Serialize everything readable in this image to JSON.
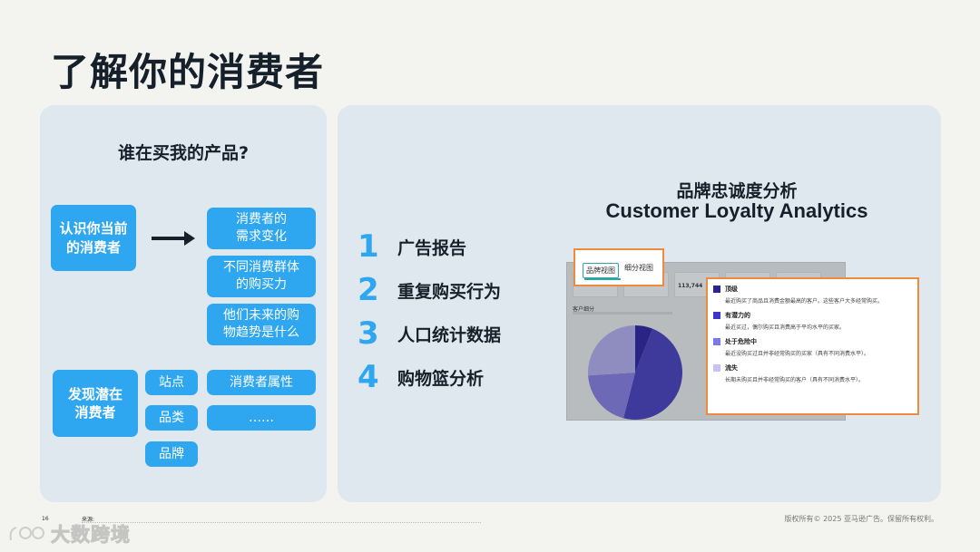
{
  "title": "了解你的消费者",
  "left_panel": {
    "heading": "谁在买我的产品?",
    "current_label": "认识你当前\n的消费者",
    "current_items": [
      "消费者的\n需求变化",
      "不同消费群体\n的购买力",
      "他们未来的购\n物趋势是什么"
    ],
    "discover_label": "发现潜在\n消费者",
    "small_items": [
      "站点",
      "品类",
      "品牌"
    ],
    "wide_items": [
      "消费者属性",
      "……"
    ]
  },
  "right_panel": {
    "list": [
      {
        "num": "1",
        "text": "广告报告"
      },
      {
        "num": "2",
        "text": "重复购买行为"
      },
      {
        "num": "3",
        "text": "人口统计数据"
      },
      {
        "num": "4",
        "text": "购物篮分析"
      }
    ],
    "title_cn": "品牌忠诚度分析",
    "title_en": "Customer Loyalty Analytics",
    "screenshot": {
      "tabs": [
        "品牌视图",
        "细分视图"
      ],
      "card_value": "113,744",
      "section_label": "客户细分",
      "legend": [
        {
          "label": "顶级",
          "color": "#2a2490",
          "desc": "最近购买了商品且消费金额最高的客户。这些客户大多经常购买。"
        },
        {
          "label": "有潜力的",
          "color": "#3d36c8",
          "desc": "最近买过，偶尔购买且消费高于平均水平的买家。"
        },
        {
          "label": "处于危险中",
          "color": "#7d78e8",
          "desc": "最近没购买过且并非经常购买的买家（具有不同消费水平）。"
        },
        {
          "label": "流失",
          "color": "#c6c3f2",
          "desc": "长期未购买且并非经常购买的客户（具有不同消费水平）。"
        }
      ],
      "pie": {
        "values": [
          0.06,
          0.48,
          0.2,
          0.26
        ],
        "colors": [
          "#2a2584",
          "#3e3a9c",
          "#6e69b6",
          "#8f8cc0"
        ]
      }
    }
  },
  "footer": {
    "page_number": "16",
    "source_label": "来源:",
    "copyright": "版权所有© 2025 亚马逊广告。保留所有权利。"
  },
  "watermark": "大数跨境"
}
